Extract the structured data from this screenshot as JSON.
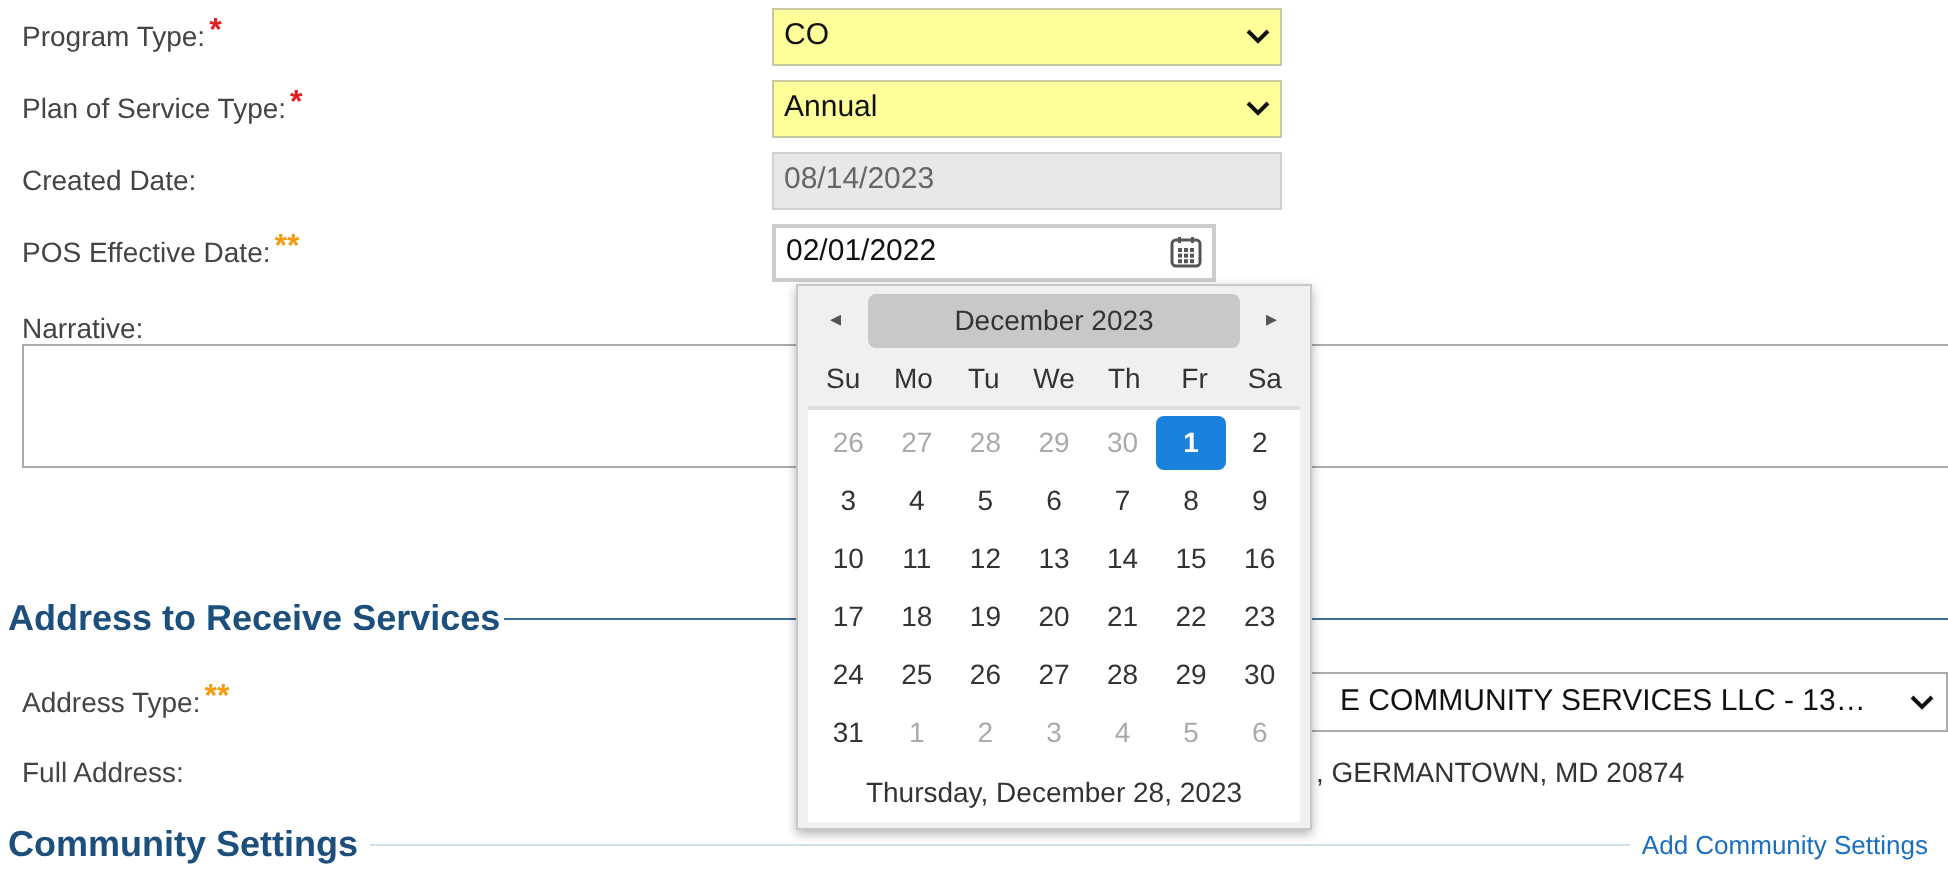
{
  "fields": [
    {
      "label": "Program Type:",
      "required": {
        "mark": "*",
        "color": "#e02020"
      },
      "kind": "select",
      "value": "CO",
      "highlighted": true,
      "disabled": false
    },
    {
      "label": "Plan of Service Type:",
      "required": {
        "mark": "*",
        "color": "#e02020"
      },
      "kind": "select",
      "value": "Annual",
      "highlighted": true,
      "disabled": false
    },
    {
      "label": "Created Date:",
      "kind": "text",
      "value": "08/14/2023",
      "highlighted": false,
      "disabled": true
    },
    {
      "label": "POS Effective Date:",
      "required": {
        "mark": "**",
        "color": "#f39c12"
      },
      "kind": "date",
      "value": "02/01/2022",
      "highlighted": false,
      "disabled": false,
      "focused": true
    }
  ],
  "narrative": {
    "label": "Narrative:"
  },
  "address_section": {
    "title": "Address to Receive Services",
    "fields": [
      {
        "label": "Address Type:",
        "required": {
          "mark": "**",
          "color": "#f39c12"
        },
        "kind": "select",
        "value": "E COMMUNITY SERVICES LLC - 13…"
      },
      {
        "label": "Full Address:",
        "kind": "static",
        "value": ", GERMANTOWN, MD 20874"
      }
    ]
  },
  "community_section": {
    "title": "Community Settings",
    "link": "Add Community Settings"
  },
  "calendar": {
    "prev": "◂",
    "next": "▸",
    "month": "December 2023",
    "weekdays": [
      "Su",
      "Mo",
      "Tu",
      "We",
      "Th",
      "Fr",
      "Sa"
    ],
    "weeks": [
      [
        {
          "label": "26",
          "other_month": true,
          "selected": false
        },
        {
          "label": "27",
          "other_month": true,
          "selected": false
        },
        {
          "label": "28",
          "other_month": true,
          "selected": false
        },
        {
          "label": "29",
          "other_month": true,
          "selected": false
        },
        {
          "label": "30",
          "other_month": true,
          "selected": false
        },
        {
          "label": "1",
          "other_month": false,
          "selected": true
        },
        {
          "label": "2",
          "other_month": false,
          "selected": false
        }
      ],
      [
        {
          "label": "3",
          "other_month": false,
          "selected": false
        },
        {
          "label": "4",
          "other_month": false,
          "selected": false
        },
        {
          "label": "5",
          "other_month": false,
          "selected": false
        },
        {
          "label": "6",
          "other_month": false,
          "selected": false
        },
        {
          "label": "7",
          "other_month": false,
          "selected": false
        },
        {
          "label": "8",
          "other_month": false,
          "selected": false
        },
        {
          "label": "9",
          "other_month": false,
          "selected": false
        }
      ],
      [
        {
          "label": "10",
          "other_month": false,
          "selected": false
        },
        {
          "label": "11",
          "other_month": false,
          "selected": false
        },
        {
          "label": "12",
          "other_month": false,
          "selected": false
        },
        {
          "label": "13",
          "other_month": false,
          "selected": false
        },
        {
          "label": "14",
          "other_month": false,
          "selected": false
        },
        {
          "label": "15",
          "other_month": false,
          "selected": false
        },
        {
          "label": "16",
          "other_month": false,
          "selected": false
        }
      ],
      [
        {
          "label": "17",
          "other_month": false,
          "selected": false
        },
        {
          "label": "18",
          "other_month": false,
          "selected": false
        },
        {
          "label": "19",
          "other_month": false,
          "selected": false
        },
        {
          "label": "20",
          "other_month": false,
          "selected": false
        },
        {
          "label": "21",
          "other_month": false,
          "selected": false
        },
        {
          "label": "22",
          "other_month": false,
          "selected": false
        },
        {
          "label": "23",
          "other_month": false,
          "selected": false
        }
      ],
      [
        {
          "label": "24",
          "other_month": false,
          "selected": false
        },
        {
          "label": "25",
          "other_month": false,
          "selected": false
        },
        {
          "label": "26",
          "other_month": false,
          "selected": false
        },
        {
          "label": "27",
          "other_month": false,
          "selected": false
        },
        {
          "label": "28",
          "other_month": false,
          "selected": false
        },
        {
          "label": "29",
          "other_month": false,
          "selected": false
        },
        {
          "label": "30",
          "other_month": false,
          "selected": false
        }
      ],
      [
        {
          "label": "31",
          "other_month": false,
          "selected": false
        },
        {
          "label": "1",
          "other_month": true,
          "selected": false
        },
        {
          "label": "2",
          "other_month": true,
          "selected": false
        },
        {
          "label": "3",
          "other_month": true,
          "selected": false
        },
        {
          "label": "4",
          "other_month": true,
          "selected": false
        },
        {
          "label": "5",
          "other_month": true,
          "selected": false
        },
        {
          "label": "6",
          "other_month": true,
          "selected": false
        }
      ]
    ],
    "today": "Thursday, December 28, 2023"
  }
}
